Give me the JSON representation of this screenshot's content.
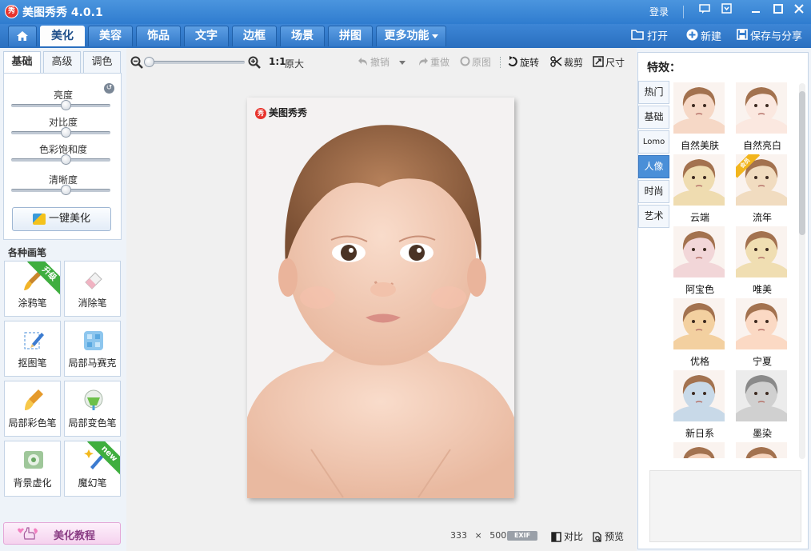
{
  "app": {
    "title": "美图秀秀 4.0.1",
    "logo_text": "秀",
    "login": "登录"
  },
  "menu": {
    "tabs": [
      "美化",
      "美容",
      "饰品",
      "文字",
      "边框",
      "场景",
      "拼图",
      "更多功能"
    ],
    "actions": {
      "open": "打开",
      "new": "新建",
      "save_share": "保存与分享"
    }
  },
  "left": {
    "sub_tabs": [
      "基础",
      "高级",
      "调色"
    ],
    "sliders": [
      {
        "label": "亮度",
        "value": 0.5
      },
      {
        "label": "对比度",
        "value": 0.5
      },
      {
        "label": "色彩饱和度",
        "value": 0.5
      },
      {
        "label": "清晰度",
        "value": 0.5
      }
    ],
    "one_click": "一键美化",
    "brush_title": "各种画笔",
    "brushes": [
      {
        "label": "涂鸦笔",
        "badge": "升级"
      },
      {
        "label": "消除笔",
        "badge": ""
      },
      {
        "label": "抠图笔",
        "badge": ""
      },
      {
        "label": "局部马赛克",
        "badge": ""
      },
      {
        "label": "局部彩色笔",
        "badge": ""
      },
      {
        "label": "局部变色笔",
        "badge": ""
      },
      {
        "label": "背景虚化",
        "badge": ""
      },
      {
        "label": "魔幻笔",
        "badge": "new"
      }
    ],
    "tutorial": "美化教程"
  },
  "canvas": {
    "ratio": "1:1",
    "actual_size": "原大",
    "undo": "撤销",
    "redo": "重做",
    "original": "原图",
    "rotate": "旋转",
    "crop": "裁剪",
    "resize": "尺寸",
    "watermark": "美图秀秀",
    "width": "333",
    "times": "×",
    "height": "500",
    "exif": "EXIF",
    "compare": "对比",
    "preview": "预览"
  },
  "right": {
    "title": "特效：",
    "categories": [
      "热门",
      "基础",
      "Lomo",
      "人像",
      "时尚",
      "艺术"
    ],
    "active_category": "人像",
    "effects": [
      {
        "label": "自然美肤",
        "tint": "#f6d8c6"
      },
      {
        "label": "自然亮白",
        "tint": "#fbe8e0"
      },
      {
        "label": "云端",
        "tint": "#efdcb0"
      },
      {
        "label": "流年",
        "tint": "#f1dcc0",
        "badge": "会员"
      },
      {
        "label": "阿宝色",
        "tint": "#f2d6d8"
      },
      {
        "label": "唯美",
        "tint": "#f0deb2"
      },
      {
        "label": "优格",
        "tint": "#f3d0a0"
      },
      {
        "label": "宁夏",
        "tint": "#fbd9c4"
      },
      {
        "label": "新日系",
        "tint": "#c8d9e8"
      },
      {
        "label": "墨染",
        "tint": "#d8d8d8"
      },
      {
        "label": "",
        "tint": "#f6d4be"
      },
      {
        "label": "",
        "tint": "#f6d4be"
      }
    ]
  }
}
